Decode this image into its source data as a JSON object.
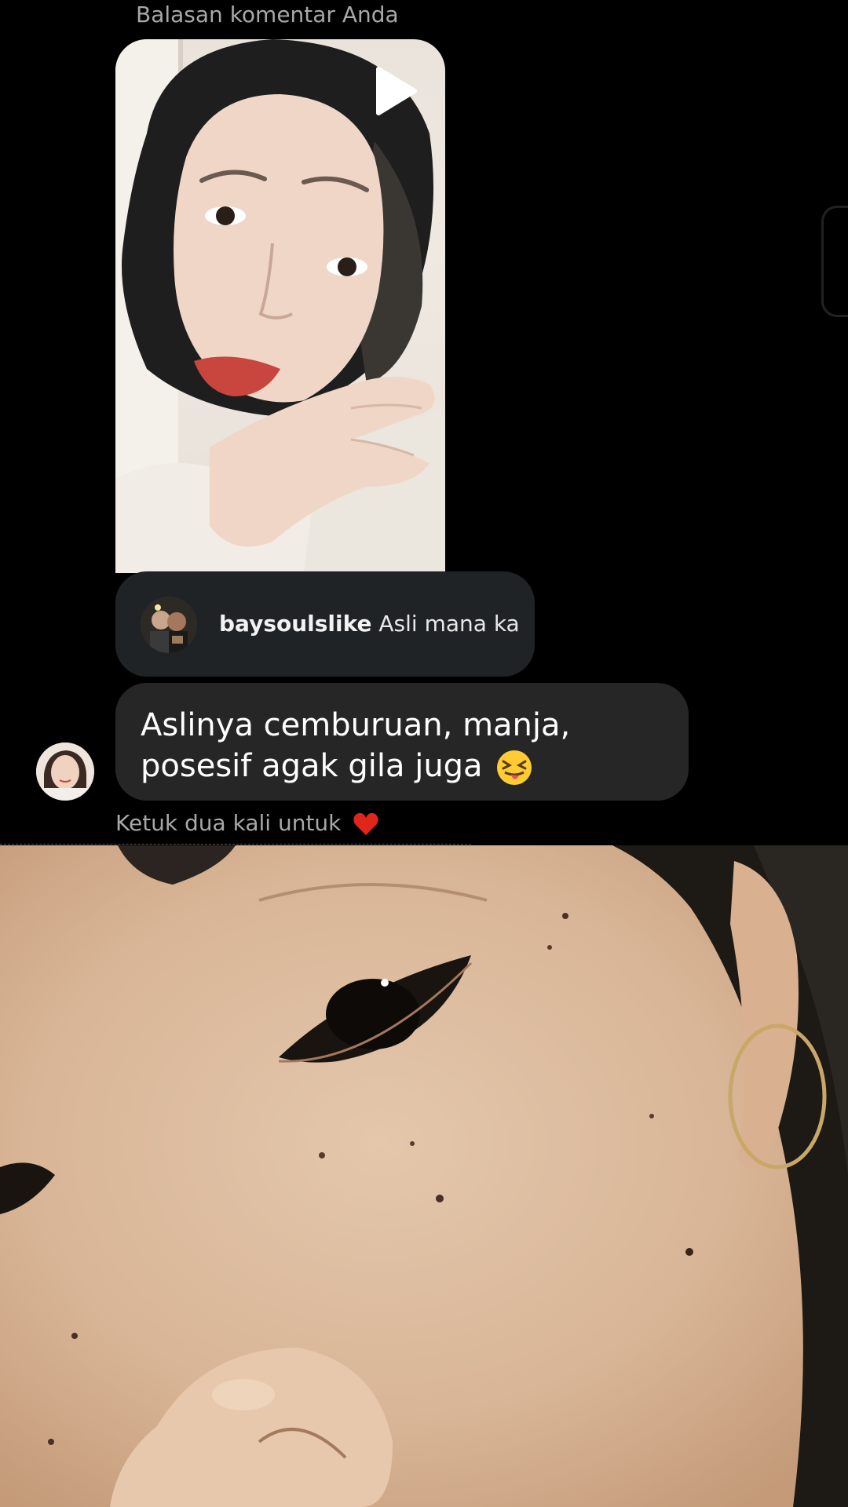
{
  "chat": {
    "reply_header": "Balasan komentar Anda",
    "story": {
      "media_type": "video",
      "icon": "play-icon"
    },
    "reply_preview": {
      "username": "baysoulslike",
      "comment": "Asli mana ka"
    },
    "message": {
      "text": "Aslinya cemburuan, manja, posesif agak gila juga",
      "emoji": "squinting-face-with-tongue"
    },
    "double_tap_hint": "Ketuk dua kali untuk",
    "double_tap_icon": "heart-icon"
  },
  "colors": {
    "background": "#000000",
    "bubble": "#262626",
    "reply_bubble": "#1f2326",
    "secondary_text": "#a8a8a8",
    "heart": "#e0261b"
  }
}
